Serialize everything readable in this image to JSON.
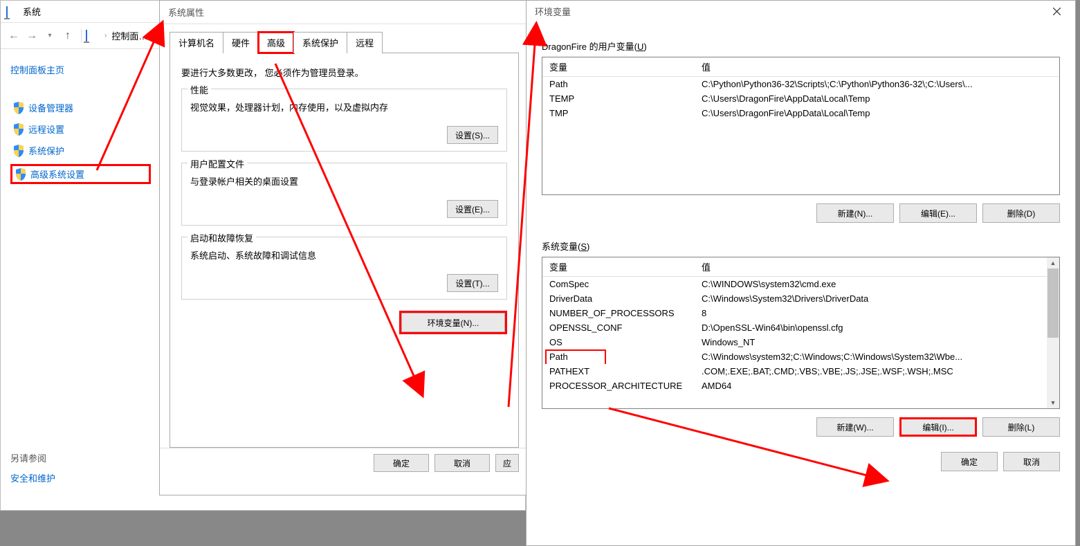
{
  "system_window": {
    "title": "系统",
    "breadcrumb": "控制面…",
    "sidebar": {
      "home": "控制面板主页",
      "items": [
        {
          "label": "设备管理器"
        },
        {
          "label": "远程设置"
        },
        {
          "label": "系统保护"
        },
        {
          "label": "高级系统设置"
        }
      ],
      "footer_title": "另请参阅",
      "footer_link": "安全和维护"
    }
  },
  "sysprop_dialog": {
    "title": "系统属性",
    "tabs": [
      "计算机名",
      "硬件",
      "高级",
      "系统保护",
      "远程"
    ],
    "active_tab": 2,
    "admin_notice": "要进行大多数更改，  您必须作为管理员登录。",
    "groups": {
      "perf": {
        "title": "性能",
        "desc": "视觉效果，处理器计划，内存使用，以及虚拟内存",
        "btn": "设置(S)..."
      },
      "profile": {
        "title": "用户配置文件",
        "desc": "与登录帐户相关的桌面设置",
        "btn": "设置(E)..."
      },
      "startup": {
        "title": "启动和故障恢复",
        "desc": "系统启动、系统故障和调试信息",
        "btn": "设置(T)..."
      }
    },
    "env_btn": "环境变量(N)...",
    "ok_btn": "确定",
    "cancel_btn": "取消",
    "apply_btn": "应"
  },
  "env_dialog": {
    "title": "环境变量",
    "user_section_label_prefix": "DragonFire 的用户变量(",
    "user_section_label_key": "U",
    "user_section_label_suffix": ")",
    "sys_section_label_prefix": "系统变量(",
    "sys_section_label_key": "S",
    "sys_section_label_suffix": ")",
    "col_var": "变量",
    "col_val": "值",
    "user_vars": [
      {
        "name": "Path",
        "value": "C:\\Python\\Python36-32\\Scripts\\;C:\\Python\\Python36-32\\;C:\\Users\\..."
      },
      {
        "name": "TEMP",
        "value": "C:\\Users\\DragonFire\\AppData\\Local\\Temp"
      },
      {
        "name": "TMP",
        "value": "C:\\Users\\DragonFire\\AppData\\Local\\Temp"
      }
    ],
    "sys_vars": [
      {
        "name": "ComSpec",
        "value": "C:\\WINDOWS\\system32\\cmd.exe"
      },
      {
        "name": "DriverData",
        "value": "C:\\Windows\\System32\\Drivers\\DriverData"
      },
      {
        "name": "NUMBER_OF_PROCESSORS",
        "value": "8"
      },
      {
        "name": "OPENSSL_CONF",
        "value": "D:\\OpenSSL-Win64\\bin\\openssl.cfg"
      },
      {
        "name": "OS",
        "value": "Windows_NT"
      },
      {
        "name": "Path",
        "value": "C:\\Windows\\system32;C:\\Windows;C:\\Windows\\System32\\Wbe..."
      },
      {
        "name": "PATHEXT",
        "value": ".COM;.EXE;.BAT;.CMD;.VBS;.VBE;.JS;.JSE;.WSF;.WSH;.MSC"
      },
      {
        "name": "PROCESSOR_ARCHITECTURE",
        "value": "AMD64"
      }
    ],
    "btns": {
      "new_user": "新建(N)...",
      "edit_user": "编辑(E)...",
      "del_user": "删除(D)",
      "new_sys": "新建(W)...",
      "edit_sys": "编辑(I)...",
      "del_sys": "删除(L)",
      "ok": "确定",
      "cancel": "取消"
    }
  }
}
